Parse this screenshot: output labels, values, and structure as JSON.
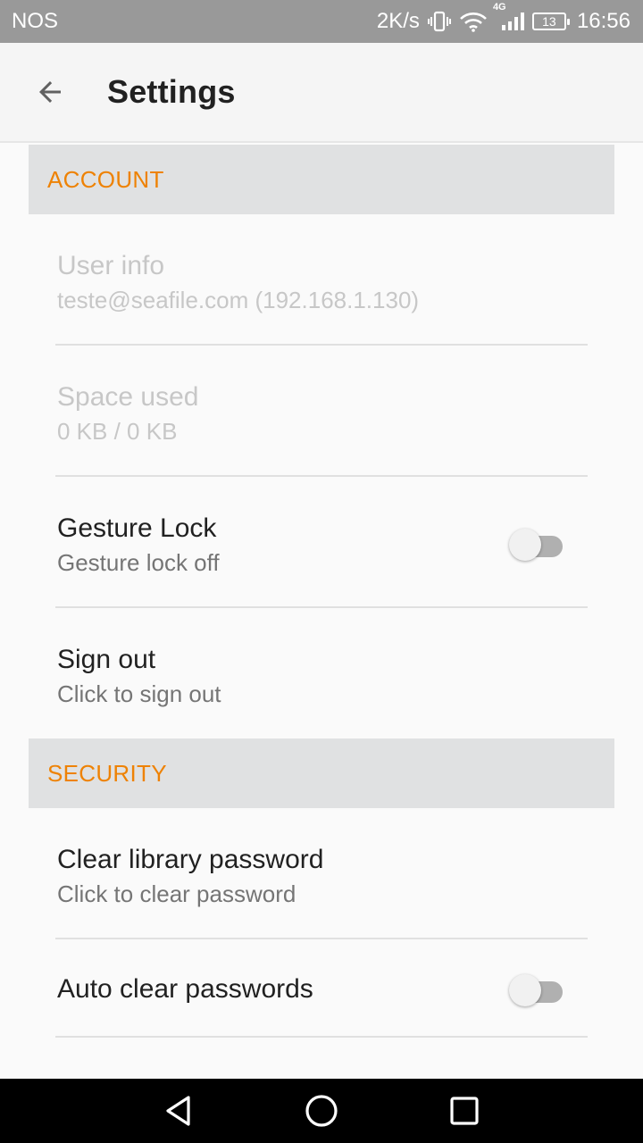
{
  "status_bar": {
    "carrier": "NOS",
    "net_speed": "2K/s",
    "network_type": "4G",
    "battery": "13",
    "time": "16:56",
    "icons": [
      "vibrate-icon",
      "wifi-icon",
      "signal-icon",
      "battery-icon"
    ]
  },
  "toolbar": {
    "back_icon": "arrow-back-icon",
    "title": "Settings"
  },
  "sections": {
    "account": {
      "header": "ACCOUNT",
      "items": [
        {
          "title": "User info",
          "summary": "teste@seafile.com (192.168.1.130)",
          "enabled": false
        },
        {
          "title": "Space used",
          "summary": "0 KB / 0 KB",
          "enabled": false
        },
        {
          "title": "Gesture Lock",
          "summary": "Gesture lock off",
          "enabled": true,
          "switch_on": false
        },
        {
          "title": "Sign out",
          "summary": "Click to sign out",
          "enabled": true
        }
      ]
    },
    "security": {
      "header": "SECURITY",
      "items": [
        {
          "title": "Clear library password",
          "summary": "Click to clear password",
          "enabled": true
        },
        {
          "title": "Auto clear passwords",
          "enabled": true,
          "switch_on": false
        }
      ]
    }
  },
  "nav_bar": {
    "icons": [
      "back-triangle-icon",
      "home-circle-icon",
      "recents-square-icon"
    ]
  },
  "colors": {
    "accent": "#ee8204",
    "status_bar": "#999999",
    "section_bg": "#e0e1e2"
  }
}
